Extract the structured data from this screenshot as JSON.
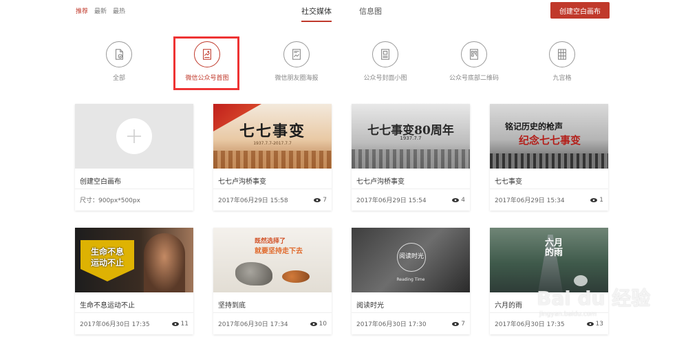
{
  "sort": {
    "items": [
      {
        "label": "推荐",
        "active": true
      },
      {
        "label": "最新",
        "active": false
      },
      {
        "label": "最热",
        "active": false
      }
    ]
  },
  "tabs": [
    {
      "label": "社交媒体",
      "active": true
    },
    {
      "label": "信息图",
      "active": false
    }
  ],
  "create_button": {
    "label": "创建空白画布"
  },
  "categories": [
    {
      "label": "全部",
      "icon": "all-docs-icon",
      "active": false
    },
    {
      "label": "微信公众号首图",
      "icon": "wechat-cover-icon",
      "active": true
    },
    {
      "label": "微信朋友圈海报",
      "icon": "moments-poster-icon",
      "active": false
    },
    {
      "label": "公众号封面小图",
      "icon": "small-cover-icon",
      "active": false
    },
    {
      "label": "公众号底部二维码",
      "icon": "qr-code-icon",
      "active": false
    },
    {
      "label": "九宫格",
      "icon": "nine-grid-icon",
      "active": false
    }
  ],
  "cards": [
    {
      "title": "创建空白画布",
      "meta": "尺寸：900px*500px",
      "views": "",
      "thumb_text": "",
      "blank": true
    },
    {
      "title": "七七卢沟桥事变",
      "meta": "2017年06月29日 15:58",
      "views": "7",
      "thumb_text": "七七事变",
      "thumb_sub": "1937.7.7-2017.7.7"
    },
    {
      "title": "七七卢沟桥事变",
      "meta": "2017年06月29日 15:54",
      "views": "4",
      "thumb_text": "七七事变80周年",
      "thumb_sub": "1937.7.7"
    },
    {
      "title": "七七事变",
      "meta": "2017年06月29日 15:34",
      "views": "1",
      "thumb_text": "铭记历史的枪声",
      "thumb_sub": "纪念七七事变"
    },
    {
      "title": "生命不息运动不止",
      "meta": "2017年06月30日 17:35",
      "views": "11",
      "thumb_text": "生命不息",
      "thumb_sub": "运动不止"
    },
    {
      "title": "坚持到底",
      "meta": "2017年06月30日 17:34",
      "views": "10",
      "thumb_text": "既然选择了",
      "thumb_sub": "就要坚持走下去"
    },
    {
      "title": "阅读时光",
      "meta": "2017年06月30日 17:30",
      "views": "7",
      "thumb_text": "阅读时光",
      "thumb_sub": "Reading Time"
    },
    {
      "title": "六月的雨",
      "meta": "2017年06月30日 17:35",
      "views": "13",
      "thumb_text": "六月的雨",
      "thumb_sub": ""
    }
  ],
  "watermark": {
    "text": "Bai du 经验",
    "sub": "jingyan.baidu.com"
  },
  "colors": {
    "accent": "#c0392b",
    "highlight": "#ee3333"
  }
}
